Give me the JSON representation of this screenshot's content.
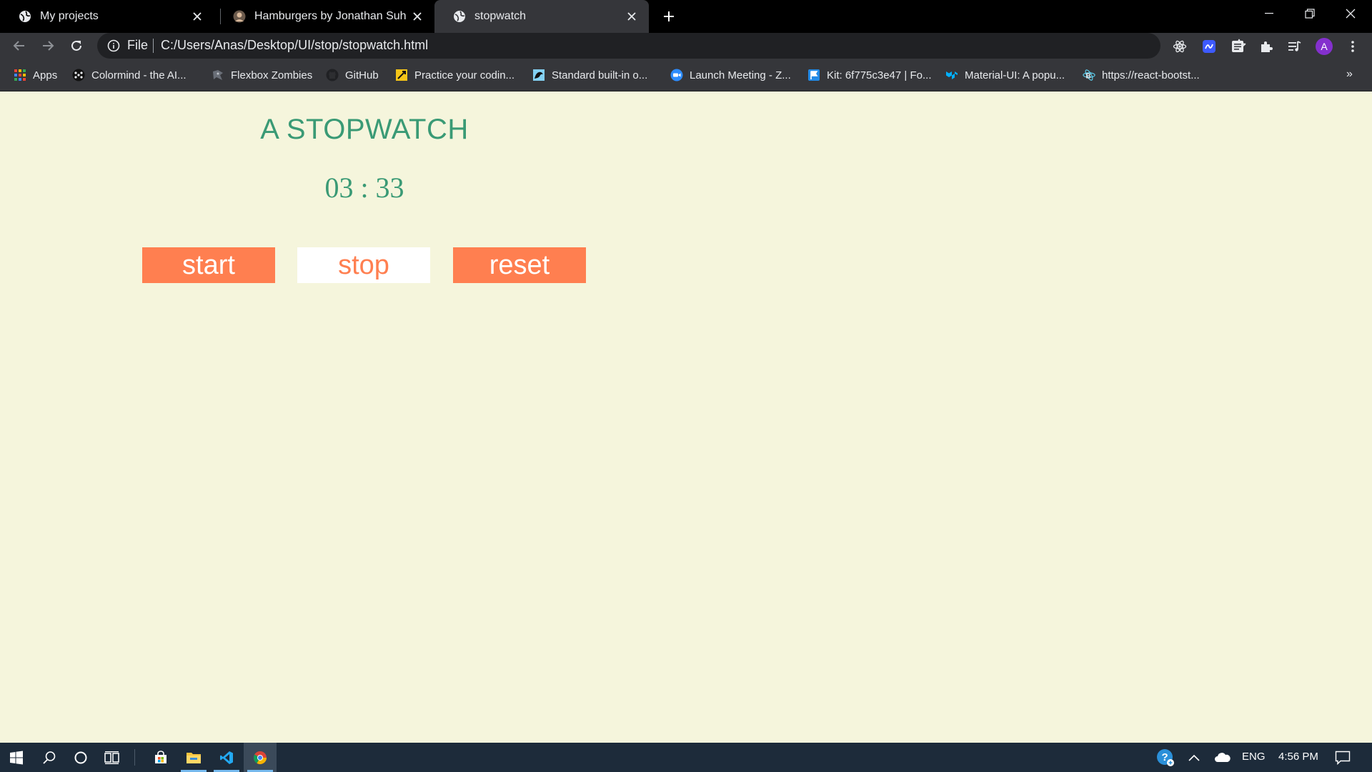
{
  "browser": {
    "tabs": [
      {
        "title": "My projects",
        "icon": "globe-icon"
      },
      {
        "title": "Hamburgers by Jonathan Suh",
        "icon": "avatar-favicon"
      },
      {
        "title": "stopwatch",
        "icon": "globe-icon"
      }
    ],
    "active_tab_index": 2,
    "address": {
      "scheme_label": "File",
      "url": "C:/Users/Anas/Desktop/UI/stop/stopwatch.html"
    },
    "profile_initial": "A",
    "bookmarks": [
      {
        "label": "Apps",
        "icon": "apps-grid-icon"
      },
      {
        "label": "Colormind - the AI...",
        "icon": "colormind-icon"
      },
      {
        "label": "Flexbox Zombies",
        "icon": "zombie-icon"
      },
      {
        "label": "GitHub",
        "icon": "github-icon"
      },
      {
        "label": "Practice your codin...",
        "icon": "codewars-icon"
      },
      {
        "label": "Standard built-in o...",
        "icon": "mdn-icon"
      },
      {
        "label": "Launch Meeting - Z...",
        "icon": "zoom-icon"
      },
      {
        "label": "Kit: 6f775c3e47 | Fo...",
        "icon": "fontawesome-flag-icon"
      },
      {
        "label": "Material-UI: A popu...",
        "icon": "material-ui-icon"
      },
      {
        "label": "https://react-bootst...",
        "icon": "react-bootstrap-icon"
      }
    ],
    "bookmarks_overflow": "»"
  },
  "page": {
    "title": "A STOPWATCH",
    "time": "03 : 33",
    "buttons": {
      "start": "start",
      "stop": "stop",
      "reset": "reset"
    },
    "colors": {
      "background": "#f5f5dc",
      "heading": "#3a9a75",
      "button": "#ff7f50"
    }
  },
  "taskbar": {
    "language": "ENG",
    "time": "4:56 PM"
  }
}
